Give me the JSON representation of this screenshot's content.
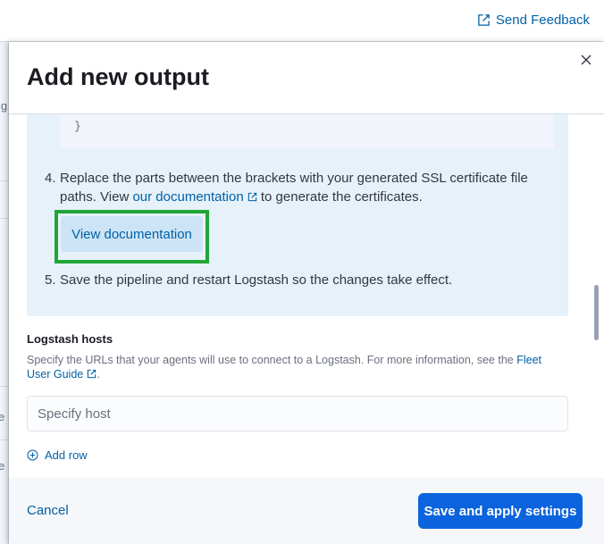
{
  "topbar": {
    "feedback_label": "Send Feedback"
  },
  "behind": {
    "fragments": [
      "ig",
      "e",
      "e"
    ]
  },
  "flyout": {
    "title": "Add new output",
    "code_tail": "}",
    "steps": [
      {
        "num": "4.",
        "text_before": "Replace the parts between the brackets with your generated SSL certificate file paths. View ",
        "link": "our documentation",
        "text_after": " to generate the certificates."
      },
      {
        "num": "5.",
        "text": "Save the pipeline and restart Logstash so the changes take effect."
      }
    ],
    "view_doc_button": "View documentation",
    "hosts": {
      "label": "Logstash hosts",
      "help_before": "Specify the URLs that your agents will use to connect to a Logstash. For more information, see the ",
      "help_link": "Fleet User Guide",
      "help_after": ".",
      "placeholder": "Specify host",
      "add_row": "Add row"
    },
    "footer": {
      "cancel": "Cancel",
      "save": "Save and apply settings"
    }
  },
  "colors": {
    "link": "#0061a6",
    "primary": "#0b64dd",
    "callout": "#e6f1fa",
    "highlight": "#1fa637"
  }
}
